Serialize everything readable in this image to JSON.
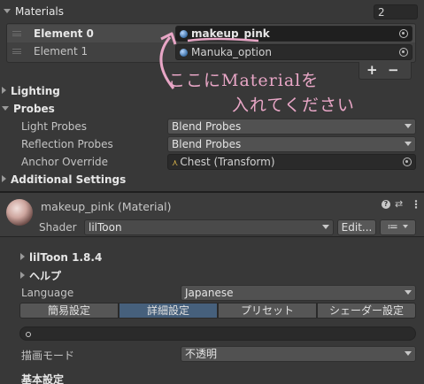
{
  "materials": {
    "header": "Materials",
    "count": "2",
    "elements": [
      {
        "label": "Element 0",
        "value": "makeup_pink"
      },
      {
        "label": "Element 1",
        "value": "Manuka_option"
      }
    ],
    "add_label": "+",
    "remove_label": "−"
  },
  "annotation": {
    "line1": "ここにMaterialを",
    "line2": "入れてください",
    "color": "#e8a6c6"
  },
  "lighting": {
    "header": "Lighting"
  },
  "probes": {
    "header": "Probes",
    "light_label": "Light Probes",
    "light_value": "Blend Probes",
    "reflection_label": "Reflection Probes",
    "reflection_value": "Blend Probes",
    "anchor_label": "Anchor Override",
    "anchor_value": "Chest (Transform)"
  },
  "additional": {
    "header": "Additional Settings"
  },
  "material_panel": {
    "title": "makeup_pink (Material)",
    "shader_label": "Shader",
    "shader_value": "lilToon",
    "edit_label": "Edit...",
    "list_icon": "≔"
  },
  "liltoon": {
    "version": "lilToon 1.8.4",
    "help": "ヘルプ",
    "language_label": "Language",
    "language_value": "Japanese",
    "tabs": [
      "簡易設定",
      "詳細設定",
      "プリセット",
      "シェーダー設定"
    ],
    "active_tab": 1,
    "search_placeholder": "",
    "render_mode_label": "描画モード",
    "render_mode_value": "不透明",
    "basic_settings": "基本設定"
  },
  "colors": {
    "active_tab": "#46607c",
    "background": "#383838"
  }
}
